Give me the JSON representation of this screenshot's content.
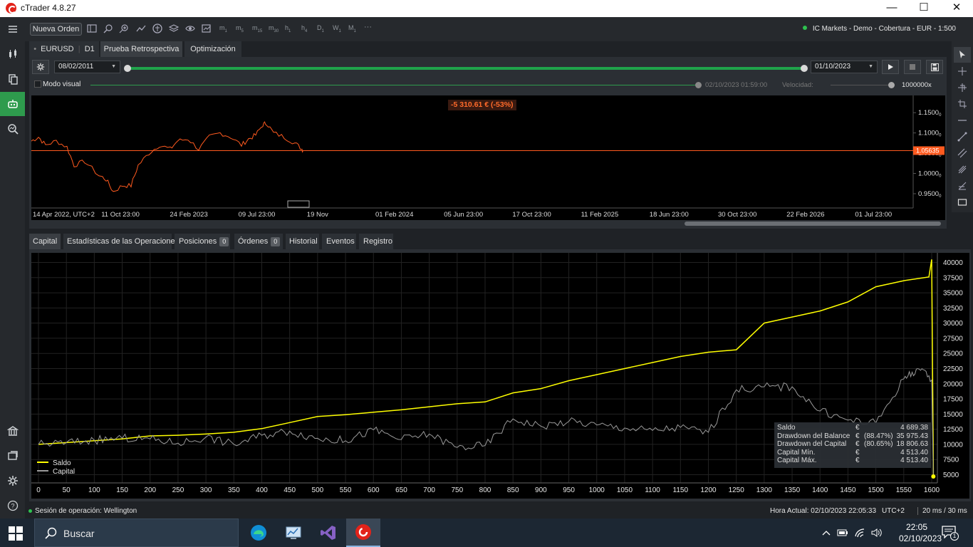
{
  "window": {
    "title": "cTrader 4.8.27",
    "minimize": "—",
    "maximize": "☐",
    "close": "✕"
  },
  "toolbar": {
    "new_order": "Nueva Orden",
    "timeframes": [
      {
        "main": "m",
        "sub": "1"
      },
      {
        "main": "m",
        "sub": "5"
      },
      {
        "main": "m",
        "sub": "15"
      },
      {
        "main": "m",
        "sub": "30"
      },
      {
        "main": "h",
        "sub": "1"
      },
      {
        "main": "h",
        "sub": "4"
      },
      {
        "main": "D",
        "sub": "1"
      },
      {
        "main": "W",
        "sub": "1"
      },
      {
        "main": "M",
        "sub": "1"
      }
    ],
    "more": "···",
    "account": "IC Markets - Demo - Cobertura - EUR - 1:500"
  },
  "top_tabs": [
    {
      "symbol": "EURUSD",
      "period": "D1"
    },
    {
      "label": "Prueba Retrospectiva"
    },
    {
      "label": "Optimización"
    }
  ],
  "backtest": {
    "start_date": "08/02/2011",
    "end_date": "01/10/2023",
    "visual_mode_label": "Modo visual",
    "sim_time": "02/10/2023 01:59:00",
    "speed_label": "Velocidad:",
    "speed_value": "1000000x",
    "progress": 1.0
  },
  "price_chart": {
    "pnl_label": "-5 310.61 € (-53%)",
    "current_price": "1.05635",
    "y_ticks": [
      {
        "label": "1.1500",
        "sub": "0",
        "value": 1.15
      },
      {
        "label": "1.1000",
        "sub": "0",
        "value": 1.1
      },
      {
        "label": "1.0500",
        "sub": "0",
        "value": 1.05
      },
      {
        "label": "1.0000",
        "sub": "0",
        "value": 1.0
      },
      {
        "label": "0.9500",
        "sub": "0",
        "value": 0.95
      }
    ],
    "x_ticks": [
      "14 Apr 2022, UTC+2",
      "11 Oct 23:00",
      "24 Feb 2023",
      "09 Jul 23:00",
      "19 Nov",
      "01 Feb 2024",
      "05 Jun 23:00",
      "17 Oct 23:00",
      "11 Feb 2025",
      "18 Jun 23:00",
      "30 Oct 23:00",
      "22 Feb 2026",
      "01 Jul 23:00"
    ],
    "line_color": "#ff5a1f"
  },
  "bottom_tabs": [
    {
      "label": "Capital"
    },
    {
      "label": "Estadísticas de las Operaciones"
    },
    {
      "label": "Posiciones",
      "badge": "0"
    },
    {
      "label": "Órdenes",
      "badge": "0"
    },
    {
      "label": "Historial"
    },
    {
      "label": "Eventos"
    },
    {
      "label": "Registro"
    }
  ],
  "chart_data": {
    "type": "line",
    "title": "",
    "xlabel": "",
    "ylabel": "",
    "xlim": [
      0,
      1600
    ],
    "ylim": [
      4000,
      41000
    ],
    "x_ticks": [
      0,
      50,
      100,
      150,
      200,
      250,
      300,
      350,
      400,
      450,
      500,
      550,
      600,
      650,
      700,
      750,
      800,
      850,
      900,
      950,
      1000,
      1050,
      1100,
      1150,
      1200,
      1250,
      1300,
      1350,
      1400,
      1450,
      1500,
      1550,
      1600
    ],
    "y_ticks": [
      5000,
      7500,
      10000,
      12500,
      15000,
      17500,
      20000,
      22500,
      25000,
      27500,
      30000,
      32500,
      35000,
      37500,
      40000
    ],
    "grid": true,
    "legend": "bottom-left",
    "series": [
      {
        "name": "Saldo",
        "color": "#ffff00",
        "x": [
          0,
          50,
          100,
          150,
          200,
          250,
          300,
          350,
          400,
          450,
          500,
          550,
          600,
          650,
          700,
          750,
          800,
          850,
          900,
          950,
          1000,
          1050,
          1100,
          1150,
          1200,
          1250,
          1300,
          1350,
          1400,
          1450,
          1500,
          1550,
          1595,
          1600,
          1603
        ],
        "y": [
          10000,
          10300,
          10600,
          10900,
          11400,
          11500,
          11700,
          12000,
          12600,
          13600,
          14600,
          14900,
          15300,
          15700,
          16200,
          16700,
          17000,
          18500,
          19200,
          20500,
          21500,
          22500,
          23500,
          24500,
          25200,
          25600,
          30000,
          31000,
          32000,
          33500,
          36000,
          37000,
          37600,
          40500,
          4700
        ]
      },
      {
        "name": "Capital",
        "color": "#9a9a9a",
        "x": [
          0,
          50,
          100,
          150,
          200,
          250,
          300,
          350,
          400,
          450,
          500,
          550,
          600,
          650,
          700,
          750,
          800,
          850,
          900,
          950,
          1000,
          1050,
          1100,
          1150,
          1200,
          1250,
          1300,
          1350,
          1400,
          1450,
          1500,
          1550,
          1575,
          1600,
          1603
        ],
        "y": [
          10000,
          10300,
          10700,
          11000,
          10900,
          10200,
          11200,
          10000,
          11500,
          12200,
          11000,
          10600,
          12400,
          10800,
          11700,
          9500,
          9800,
          14200,
          13000,
          13800,
          13200,
          12700,
          12300,
          12800,
          12000,
          19000,
          19500,
          19500,
          15500,
          14000,
          13500,
          20800,
          22500,
          20600,
          4500
        ]
      }
    ]
  },
  "stats": [
    {
      "label": "Saldo",
      "cur": "€",
      "pct": "",
      "value": "4 689.38"
    },
    {
      "label": "Drawdown del Balance",
      "cur": "€",
      "pct": "(88.47%)",
      "value": "35 975.43"
    },
    {
      "label": "Drawdown del Capital",
      "cur": "€",
      "pct": "(80.65%)",
      "value": "18 806.63"
    },
    {
      "label": "Capital Mín.",
      "cur": "€",
      "pct": "",
      "value": "4 513.40"
    },
    {
      "label": "Capital Máx.",
      "cur": "€",
      "pct": "",
      "value": "4 513.40"
    }
  ],
  "status": {
    "session": "Sesión de operación: Wellington",
    "clock": "Hora Actual: 02/10/2023 22:05:33",
    "tz": "UTC+2",
    "latency": "20 ms / 30 ms"
  },
  "taskbar": {
    "search_placeholder": "Buscar",
    "time": "22:05",
    "date": "02/10/2023",
    "notifications": "1"
  }
}
